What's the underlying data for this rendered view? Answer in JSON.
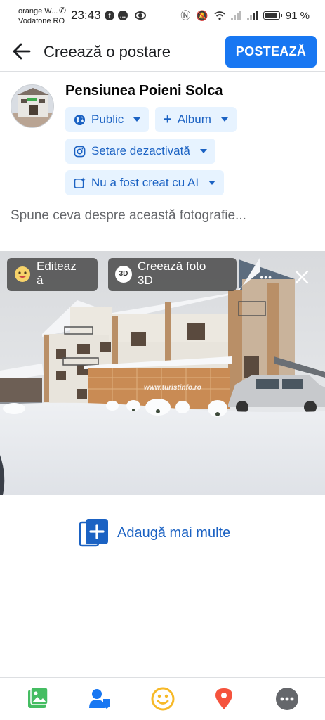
{
  "status_bar": {
    "carrier_line1": "orange W...",
    "carrier_line2": "Vodafone RO",
    "time": "23:43",
    "battery": "91 %",
    "battery_level": 0.91,
    "icons": [
      "call-icon",
      "facebook-notification-icon",
      "message-icon",
      "eye-icon",
      "nfc-icon",
      "mute-icon",
      "wifi-icon",
      "signal-icon",
      "battery-icon"
    ]
  },
  "header": {
    "title": "Creează o postare",
    "post_label": "POSTEAZĂ",
    "accent": "#1877f2"
  },
  "composer": {
    "author": "Pensiunea Poieni Solca",
    "audience_label": "Public",
    "album_label": "Album",
    "instagram_label": "Setare dezactivată",
    "ai_label": "Nu a fost creat cu AI",
    "caption_placeholder": "Spune ceva despre această fotografie..."
  },
  "photo": {
    "edit_label_line1": "Editeaz",
    "edit_label_line2": "ă",
    "create3d_label_line1": "Creează foto",
    "create3d_label_line2": "3D",
    "badge_3d": "3D",
    "watermark": "www.turistinfo.ro"
  },
  "add_more": {
    "label": "Adaugă mai multe"
  },
  "bottom_bar": {
    "items": [
      "photo-gallery-icon",
      "tag-people-icon",
      "feeling-icon",
      "location-icon",
      "more-icon"
    ],
    "colors": {
      "photo": "#45bd62",
      "people": "#1877f2",
      "feeling": "#f7b928",
      "location": "#f5533d",
      "more": "#65676b"
    }
  }
}
